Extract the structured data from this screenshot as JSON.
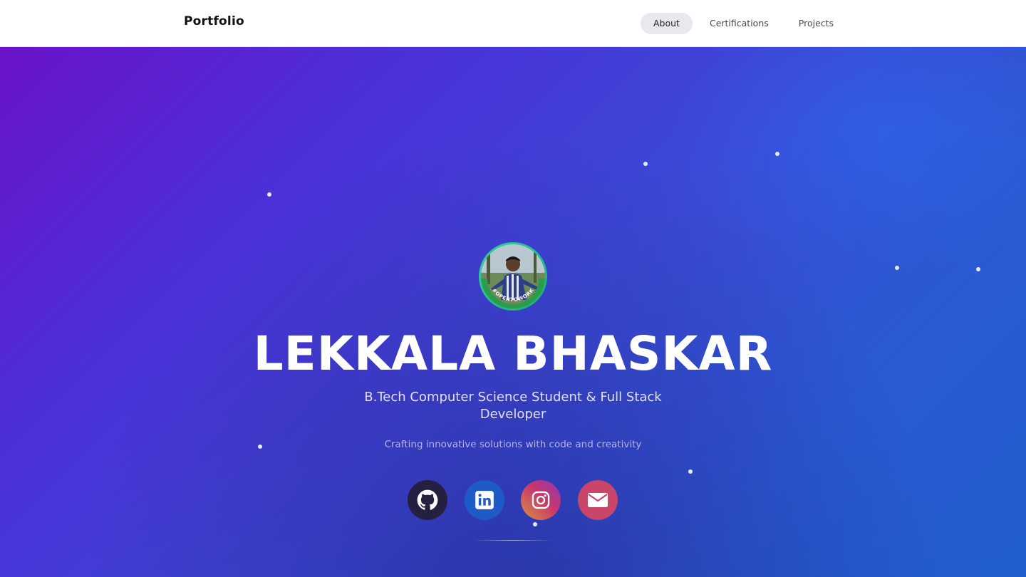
{
  "navbar": {
    "brand": "Portfolio",
    "links": [
      {
        "label": "About",
        "active": true
      },
      {
        "label": "Certifications",
        "active": false
      },
      {
        "label": "Projects",
        "active": false
      }
    ]
  },
  "hero": {
    "avatar_badge": "#OPENTOWORK",
    "name": "LEKKALA BHASKAR",
    "role": "B.Tech Computer Science Student & Full Stack Developer",
    "tagline": "Crafting innovative solutions with code and creativity",
    "social": [
      {
        "name": "github",
        "icon": "github-icon"
      },
      {
        "name": "linkedin",
        "icon": "linkedin-icon"
      },
      {
        "name": "instagram",
        "icon": "instagram-icon"
      },
      {
        "name": "email",
        "icon": "mail-icon"
      }
    ]
  },
  "colors": {
    "hero_gradient_start": "#6a13c9",
    "hero_gradient_end": "#1f5ecb",
    "avatar_ring": "#2fd3a0",
    "github": "#23213f",
    "linkedin": "#1f5bc7",
    "email": "#c9456a"
  }
}
